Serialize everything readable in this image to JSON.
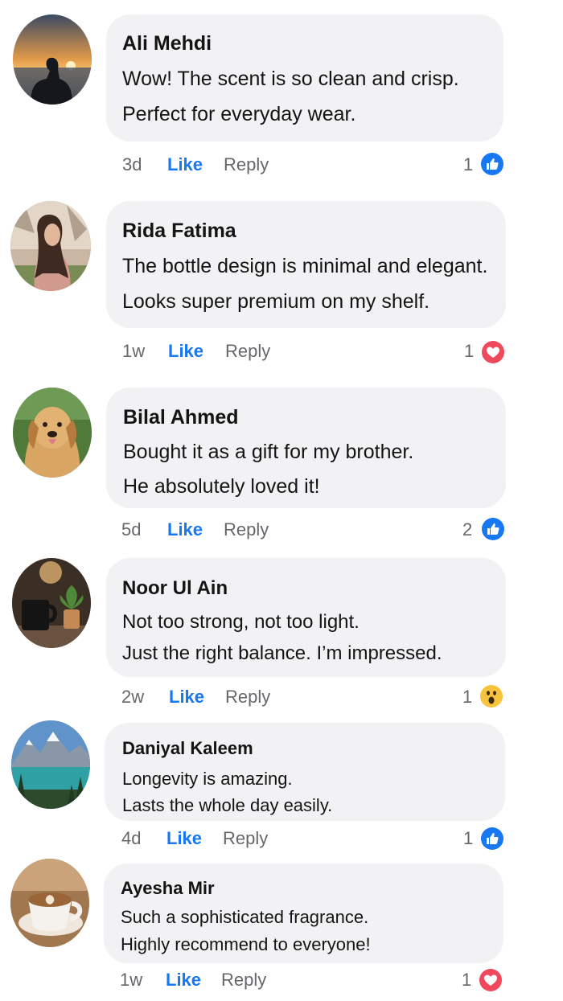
{
  "like_label": "Like",
  "reply_label": "Reply",
  "colors": {
    "bubble": "#f2f2f4",
    "like_blue": "#1877f2",
    "love_red": "#f0485c",
    "wow_yellow": "#f7c33d",
    "meta_gray": "#65676b"
  },
  "comments": [
    {
      "author": "Ali Mehdi",
      "avatar": "sunset-silhouette-avatar",
      "lines": [
        "Wow! The scent is so clean and crisp.",
        "Perfect for everyday wear."
      ],
      "time": "3d",
      "count": "1",
      "reaction": "like-reaction-icon"
    },
    {
      "author": "Rida Fatima",
      "avatar": "woman-portrait-avatar",
      "lines": [
        "The bottle design is minimal and elegant.",
        "Looks super premium on my shelf."
      ],
      "time": "1w",
      "count": "1",
      "reaction": "love-reaction-icon"
    },
    {
      "author": "Bilal Ahmed",
      "avatar": "golden-retriever-avatar",
      "lines": [
        "Bought it as a gift for my brother.",
        "He absolutely loved it!"
      ],
      "time": "5d",
      "count": "2",
      "reaction": "like-reaction-icon"
    },
    {
      "author": "Noor Ul Ain",
      "avatar": "coffee-mug-plant-avatar",
      "lines": [
        "Not too strong, not too light.",
        "Just the right balance. I’m impressed."
      ],
      "time": "2w",
      "count": "1",
      "reaction": "wow-reaction-icon"
    },
    {
      "author": "Daniyal Kaleem",
      "avatar": "mountain-lake-avatar",
      "lines": [
        "Longevity is amazing.",
        "Lasts the whole day easily."
      ],
      "time": "4d",
      "count": "1",
      "reaction": "like-reaction-icon"
    },
    {
      "author": "Ayesha Mir",
      "avatar": "latte-art-avatar",
      "lines": [
        "Such a sophisticated fragrance.",
        "Highly recommend to everyone!"
      ],
      "time": "1w",
      "count": "1",
      "reaction": "love-reaction-icon"
    }
  ]
}
